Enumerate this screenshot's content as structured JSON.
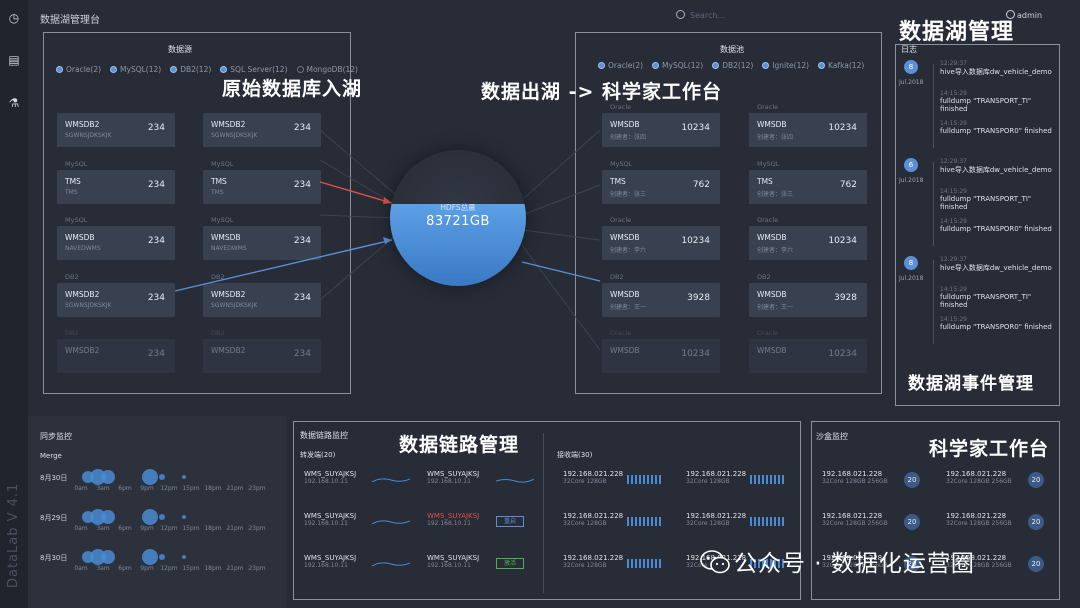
{
  "app_title": "数据湖管理台",
  "search_placeholder": "Search...",
  "user": "admin",
  "version": "DataLab V 4.1",
  "rail_icons": [
    "clock-icon",
    "list-icon",
    "flask-icon"
  ],
  "overlays": {
    "lake_mgmt": "数据湖管理",
    "ingest": "原始数据库入湖",
    "egress": "数据出湖 -> 科学家工作台",
    "event_mgmt": "数据湖事件管理",
    "link_mgmt": "数据链路管理",
    "scientist": "科学家工作台"
  },
  "source": {
    "title": "数据源",
    "legend": [
      {
        "label": "Oracle(2)",
        "on": true
      },
      {
        "label": "MySQL(12)",
        "on": true
      },
      {
        "label": "DB2(12)",
        "on": true
      },
      {
        "label": "SQL Server(12)",
        "on": true
      },
      {
        "label": "MongoDB(12)",
        "on": false
      }
    ],
    "cards": [
      {
        "type": "",
        "name": "WMSDB2",
        "sub": "SGWNSJDKSKJK",
        "num": "234"
      },
      {
        "type": "",
        "name": "WMSDB2",
        "sub": "SGWNSJDKSKJK",
        "num": "234"
      },
      {
        "type": "MySQL",
        "name": "TMS",
        "sub": "TMS",
        "num": "234"
      },
      {
        "type": "MySQL",
        "name": "TMS",
        "sub": "TMS",
        "num": "234"
      },
      {
        "type": "MySQL",
        "name": "WMSDB",
        "sub": "NAVEDWMS",
        "num": "234"
      },
      {
        "type": "MySQL",
        "name": "WMSDB",
        "sub": "NAVEDWMS",
        "num": "234"
      },
      {
        "type": "DB2",
        "name": "WMSDB2",
        "sub": "SGWNSJDKSKJK",
        "num": "234"
      },
      {
        "type": "DB2",
        "name": "WMSDB2",
        "sub": "SGWNSJDKSKJK",
        "num": "234"
      },
      {
        "type": "DB2",
        "name": "WMSDB2",
        "sub": "",
        "num": "234"
      },
      {
        "type": "DB2",
        "name": "WMSDB2",
        "sub": "",
        "num": "234"
      }
    ]
  },
  "hdfs": {
    "label": "HDFS总量",
    "value": "83721GB",
    "fill_fraction": 0.6
  },
  "pool": {
    "title": "数据池",
    "legend": [
      {
        "label": "Oracle(2)",
        "on": true
      },
      {
        "label": "MySQL(12)",
        "on": true
      },
      {
        "label": "DB2(12)",
        "on": true
      },
      {
        "label": "Ignite(12)",
        "on": true
      },
      {
        "label": "Kafka(12)",
        "on": true
      }
    ],
    "cards": [
      {
        "type": "Oracle",
        "name": "WMSDB",
        "sub": "创建者：张四",
        "num": "10234"
      },
      {
        "type": "Oracle",
        "name": "WMSDB",
        "sub": "创建者：张四",
        "num": "10234"
      },
      {
        "type": "MySQL",
        "name": "TMS",
        "sub": "创建者：张三",
        "num": "762"
      },
      {
        "type": "MySQL",
        "name": "TMS",
        "sub": "创建者：张三",
        "num": "762"
      },
      {
        "type": "Oracle",
        "name": "WMSDB",
        "sub": "创建者：李六",
        "num": "10234"
      },
      {
        "type": "Oracle",
        "name": "WMSDB",
        "sub": "创建者：李六",
        "num": "10234"
      },
      {
        "type": "DB2",
        "name": "WMSDB",
        "sub": "创建者：王一",
        "num": "3928"
      },
      {
        "type": "DB2",
        "name": "WMSDB",
        "sub": "创建者：王一",
        "num": "3928"
      },
      {
        "type": "Oracle",
        "name": "WMSDB",
        "sub": "",
        "num": "10234"
      },
      {
        "type": "Oracle",
        "name": "WMSDB",
        "sub": "",
        "num": "10234"
      }
    ]
  },
  "log": {
    "title": "日志",
    "groups": [
      {
        "day": "8",
        "date": "Jul.2018",
        "items": [
          {
            "time": "12:29:37",
            "text": "hive导入数据库dw_vehicle_demo"
          },
          {
            "time": "14:15:29",
            "text": "fulldump \"TRANSPORT_TI\" finished"
          },
          {
            "time": "14:15:29",
            "text": "fulldump \"TRANSPOR0\" finished"
          }
        ]
      },
      {
        "day": "6",
        "date": "Jul.2018",
        "items": [
          {
            "time": "12:29:37",
            "text": "hive导入数据库dw_vehicle_demo"
          },
          {
            "time": "14:15:29",
            "text": "fulldump \"TRANSPORT_TI\" finished"
          },
          {
            "time": "14:15:29",
            "text": "fulldump \"TRANSPOR0\" finished"
          }
        ]
      },
      {
        "day": "8",
        "date": "Jul.2018",
        "items": [
          {
            "time": "12:29:37",
            "text": "hive导入数据库dw_vehicle_demo"
          },
          {
            "time": "14:15:29",
            "text": "fulldump \"TRANSPORT_TI\" finished"
          },
          {
            "time": "14:15:29",
            "text": "fulldump \"TRANSPOR0\" finished"
          }
        ]
      }
    ]
  },
  "sync": {
    "title": "同步监控",
    "subtitle": "Merge",
    "hours": [
      "0am",
      "3am",
      "6pm",
      "9pm",
      "12pm",
      "15pm",
      "18pm",
      "21pm",
      "23pm"
    ],
    "rows": [
      {
        "date": "8月30日"
      },
      {
        "date": "8月29日"
      },
      {
        "date": "8月30日"
      }
    ]
  },
  "link": {
    "title": "数据链路监控",
    "sender_title": "转发端(20)",
    "receiver_title": "接收端(30)",
    "senders": [
      {
        "a_name": "WMS_SUYAJKSJ",
        "a_ip": "192.168.10.11",
        "b_name": "WMS_SUYAJKSJ",
        "b_ip": "192.168.10.11",
        "b_error": false,
        "tag": ""
      },
      {
        "a_name": "WMS_SUYAJKSJ",
        "a_ip": "192.168.10.11",
        "b_name": "WMS_SUYAJKSJ",
        "b_ip": "192.168.10.11",
        "b_error": true,
        "tag": "重启"
      },
      {
        "a_name": "WMS_SUYAJKSJ",
        "a_ip": "192.168.10.11",
        "b_name": "WMS_SUYAJKSJ",
        "b_ip": "192.168.10.11",
        "b_error": false,
        "tag": "激活"
      }
    ],
    "receivers": [
      {
        "ip": "192.168.021.228",
        "spec": "32Core 128GB"
      },
      {
        "ip": "192.168.021.228",
        "spec": "32Core 128GB"
      },
      {
        "ip": "192.168.021.228",
        "spec": "32Core 128GB"
      },
      {
        "ip": "192.168.021.228",
        "spec": "32Core 128GB"
      },
      {
        "ip": "192.168.021.228",
        "spec": "32Core 128GB"
      },
      {
        "ip": "192.168.021.228",
        "spec": "32Core 128GB"
      }
    ]
  },
  "sandbox": {
    "title": "沙盒监控",
    "items": [
      {
        "ip": "192.168.021.228",
        "spec": "32Core 128GB 256GB",
        "count": "20"
      },
      {
        "ip": "192.168.021.228",
        "spec": "32Core 128GB 256GB",
        "count": "20"
      },
      {
        "ip": "192.168.021.228",
        "spec": "32Core 128GB 256GB",
        "count": "20"
      },
      {
        "ip": "192.168.021.228",
        "spec": "32Core 128GB 256GB",
        "count": "20"
      },
      {
        "ip": "192.168.021.228",
        "spec": "32Core 128GB 256GB",
        "count": "20"
      },
      {
        "ip": "192.168.021.228",
        "spec": "32Core 128GB 256GB",
        "count": "20"
      }
    ]
  },
  "watermark": "公众号 · 数据化运营圈",
  "colors": {
    "accent": "#5b8fd6",
    "bg": "#272c37",
    "card": "#394050",
    "error": "#e0514c",
    "success": "#4caf50"
  }
}
